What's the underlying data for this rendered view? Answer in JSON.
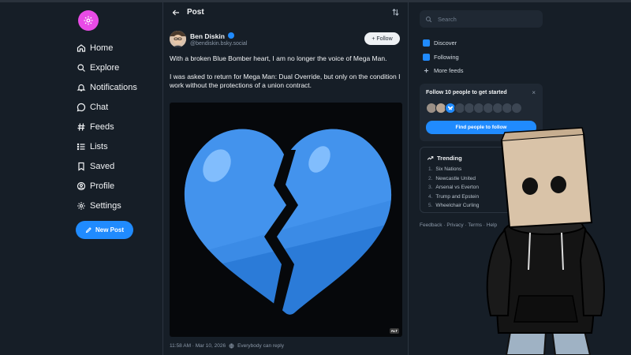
{
  "nav": {
    "items": [
      {
        "label": "Home",
        "icon": "home-icon"
      },
      {
        "label": "Explore",
        "icon": "explore-icon"
      },
      {
        "label": "Notifications",
        "icon": "bell-icon"
      },
      {
        "label": "Chat",
        "icon": "chat-icon"
      },
      {
        "label": "Feeds",
        "icon": "hash-icon"
      },
      {
        "label": "Lists",
        "icon": "list-icon"
      },
      {
        "label": "Saved",
        "icon": "bookmark-icon"
      },
      {
        "label": "Profile",
        "icon": "profile-icon"
      },
      {
        "label": "Settings",
        "icon": "gear-icon"
      }
    ],
    "new_post_label": "New Post"
  },
  "post": {
    "header_title": "Post",
    "author_name": "Ben Diskin",
    "author_handle": "@bendiskin.bsky.social",
    "follow_label": "+ Follow",
    "text_1": "With a broken Blue Bomber heart, I am no longer the voice of Mega Man.",
    "text_2": "I was asked to return for Mega Man: Dual Override, but only on the condition I work without the protections of a union contract.",
    "media_alt_badge": "ALT",
    "timestamp": "11:58 AM · Mar 10, 2026",
    "reply_setting": "Everybody can reply"
  },
  "sidebar": {
    "search_placeholder": "Search",
    "feeds": [
      {
        "label": "Discover"
      },
      {
        "label": "Following"
      },
      {
        "label": "More feeds"
      }
    ],
    "follow_card": {
      "title": "Follow 10 people to get started",
      "close": "×",
      "button_label": "Find people to follow"
    },
    "trending": {
      "title": "Trending",
      "items": [
        {
          "num": "1.",
          "label": "Six Nations"
        },
        {
          "num": "2.",
          "label": "Newcastle United"
        },
        {
          "num": "3.",
          "label": "Arsenal vs Everton"
        },
        {
          "num": "4.",
          "label": "Trump and Epstein"
        },
        {
          "num": "5.",
          "label": "Wheelchair Curling"
        }
      ]
    },
    "footer": "Feedback · Privacy · Terms · Help"
  },
  "colors": {
    "background": "#161e27",
    "accent": "#208bfe",
    "logo": "#e94be6",
    "heart": "#3d8fe8"
  }
}
